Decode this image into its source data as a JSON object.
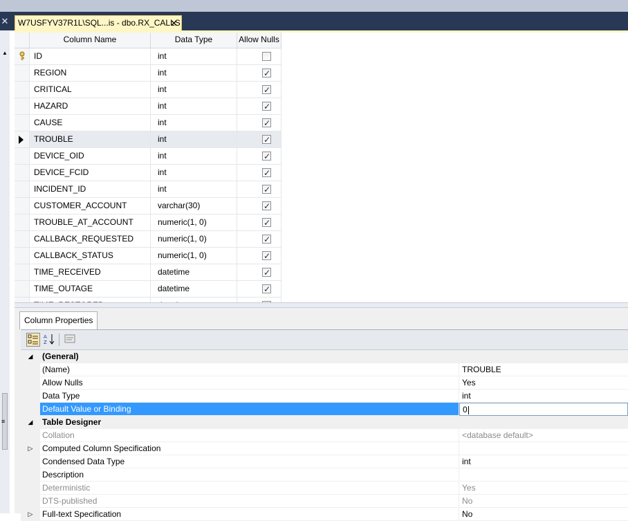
{
  "window": {
    "tab_title": "W7USFYV37R1L\\SQL...is - dbo.RX_CALLS",
    "tab_close_glyph": "✕",
    "side_close_glyph": "✕"
  },
  "grid": {
    "headers": {
      "column_name": "Column Name",
      "data_type": "Data Type",
      "allow_nulls": "Allow Nulls"
    },
    "rows": [
      {
        "name": "ID",
        "type": "int",
        "allow_nulls": false,
        "primary_key": true
      },
      {
        "name": "REGION",
        "type": "int",
        "allow_nulls": true
      },
      {
        "name": "CRITICAL",
        "type": "int",
        "allow_nulls": true
      },
      {
        "name": "HAZARD",
        "type": "int",
        "allow_nulls": true
      },
      {
        "name": "CAUSE",
        "type": "int",
        "allow_nulls": true
      },
      {
        "name": "TROUBLE",
        "type": "int",
        "allow_nulls": true,
        "selected": true
      },
      {
        "name": "DEVICE_OID",
        "type": "int",
        "allow_nulls": true
      },
      {
        "name": "DEVICE_FCID",
        "type": "int",
        "allow_nulls": true
      },
      {
        "name": "INCIDENT_ID",
        "type": "int",
        "allow_nulls": true
      },
      {
        "name": "CUSTOMER_ACCOUNT",
        "type": "varchar(30)",
        "allow_nulls": true
      },
      {
        "name": "TROUBLE_AT_ACCOUNT",
        "type": "numeric(1, 0)",
        "allow_nulls": true
      },
      {
        "name": "CALLBACK_REQUESTED",
        "type": "numeric(1, 0)",
        "allow_nulls": true
      },
      {
        "name": "CALLBACK_STATUS",
        "type": "numeric(1, 0)",
        "allow_nulls": true
      },
      {
        "name": "TIME_RECEIVED",
        "type": "datetime",
        "allow_nulls": true
      },
      {
        "name": "TIME_OUTAGE",
        "type": "datetime",
        "allow_nulls": true
      },
      {
        "name": "TIME_RESTORED",
        "type": "datetime",
        "allow_nulls": true
      }
    ]
  },
  "properties": {
    "tab_label": "Column Properties",
    "toolbar": {
      "categorized_icon": "categorized-icon",
      "alphabetical_icon": "sort-az-icon",
      "property_pages_icon": "property-pages-icon"
    },
    "rows": [
      {
        "kind": "category",
        "expander": "◢",
        "name": "(General)"
      },
      {
        "name": "(Name)",
        "value": "TROUBLE"
      },
      {
        "name": "Allow Nulls",
        "value": "Yes"
      },
      {
        "name": "Data Type",
        "value": "int"
      },
      {
        "name": "Default Value or Binding",
        "value": "0",
        "highlighted": true,
        "editing": true
      },
      {
        "kind": "category",
        "expander": "◢",
        "name": "Table Designer"
      },
      {
        "name": "Collation",
        "value": "<database default>",
        "dim": true
      },
      {
        "name": "Computed Column Specification",
        "value": "",
        "expander": "▷"
      },
      {
        "name": "Condensed Data Type",
        "value": "int"
      },
      {
        "name": "Description",
        "value": ""
      },
      {
        "name": "Deterministic",
        "value": "Yes",
        "dim": true
      },
      {
        "name": "DTS-published",
        "value": "No",
        "dim": true
      },
      {
        "name": "Full-text Specification",
        "value": "No",
        "expander": "▷"
      }
    ]
  }
}
